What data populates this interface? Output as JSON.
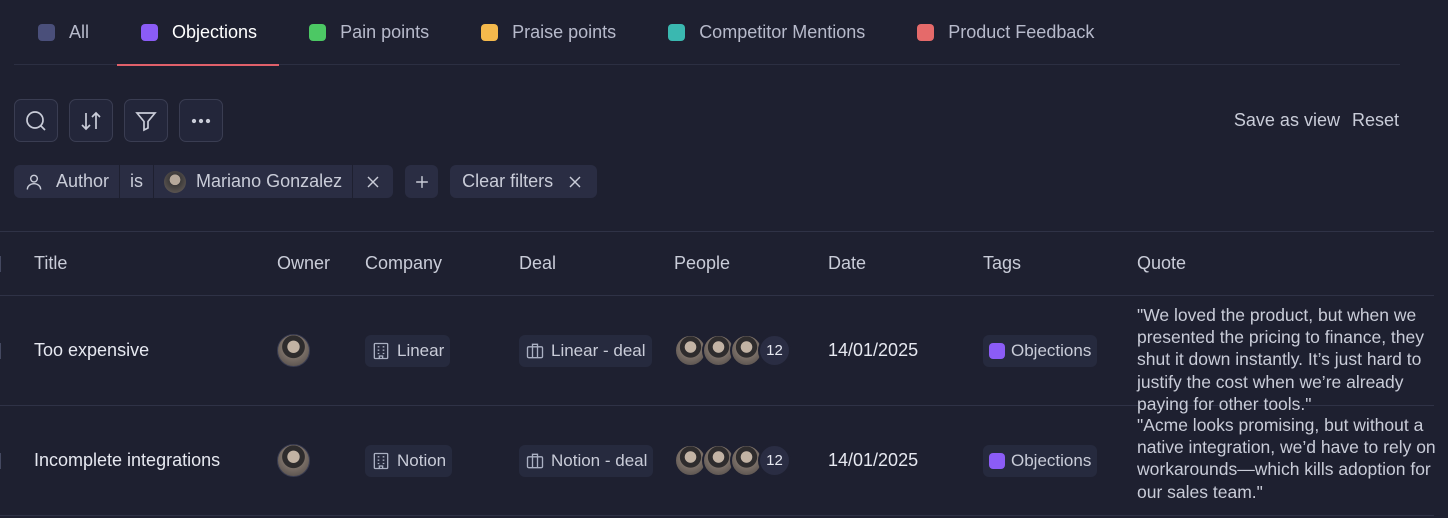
{
  "tabs": [
    {
      "label": "All",
      "color": "#4a4f7a",
      "active": false
    },
    {
      "label": "Objections",
      "color": "#8b5cf6",
      "active": true
    },
    {
      "label": "Pain points",
      "color": "#4cc864",
      "active": false
    },
    {
      "label": "Praise points",
      "color": "#f5b94c",
      "active": false
    },
    {
      "label": "Competitor Mentions",
      "color": "#3ab8b0",
      "active": false
    },
    {
      "label": "Product Feedback",
      "color": "#e56a6a",
      "active": false
    }
  ],
  "actions": {
    "save_view": "Save as view",
    "reset": "Reset"
  },
  "filter": {
    "field": "Author",
    "operator": "is",
    "value": "Mariano Gonzalez",
    "clear": "Clear filters"
  },
  "columns": {
    "title": "Title",
    "owner": "Owner",
    "company": "Company",
    "deal": "Deal",
    "people": "People",
    "date": "Date",
    "tags": "Tags",
    "quote": "Quote"
  },
  "rows": [
    {
      "title": "Too expensive",
      "company": "Linear",
      "deal": "Linear - deal",
      "people_count": "12",
      "date": "14/01/2025",
      "tag": "Objections",
      "quote": "\"We loved the product, but when we presented the pricing to finance, they shut it down instantly. It’s just hard to justify the cost when we’re already paying for other tools.\""
    },
    {
      "title": "Incomplete integrations",
      "company": "Notion",
      "deal": "Notion - deal",
      "people_count": "12",
      "date": "14/01/2025",
      "tag": "Objections",
      "quote": "\"Acme looks promising, but without a native integration, we’d have to rely on workarounds—which kills adoption for our sales team.\""
    }
  ]
}
